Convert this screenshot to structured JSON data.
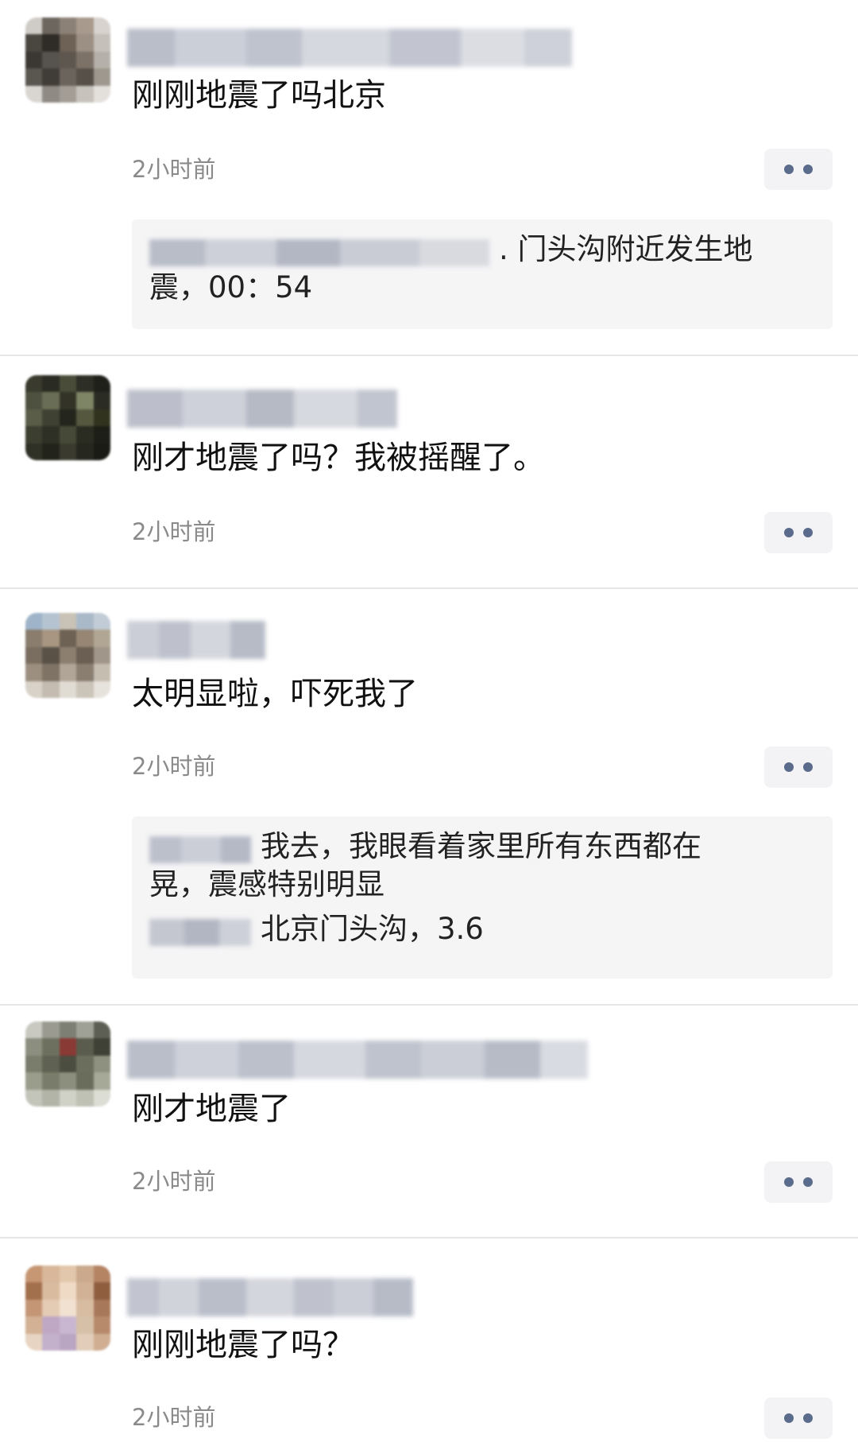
{
  "posts": [
    {
      "content": "刚刚地震了吗北京",
      "time": "2小时前",
      "replies": [
        {
          "text": ". 门头沟附近发生地"
        },
        {
          "text": "震，00：54"
        }
      ]
    },
    {
      "content": "刚才地震了吗？我被摇醒了。",
      "time": "2小时前",
      "replies": []
    },
    {
      "content": "太明显啦，吓死我了",
      "time": "2小时前",
      "replies": [
        {
          "text": "我去，我眼看着家里所有东西都在"
        },
        {
          "text": "晃，震感特别明显"
        },
        {
          "text": "北京门头沟，3.6"
        }
      ]
    },
    {
      "content": "刚才地震了",
      "time": "2小时前",
      "replies": []
    },
    {
      "content": "刚刚地震了吗？",
      "time": "2小时前",
      "replies": []
    }
  ],
  "colors": {
    "more_dot": "#5a6b8c",
    "time_text": "#8a8a8a",
    "reply_bg": "#f5f5f6",
    "divider": "#e6e6e6"
  },
  "icons": {
    "more": "more-dots-icon",
    "avatar": "user-avatar"
  }
}
